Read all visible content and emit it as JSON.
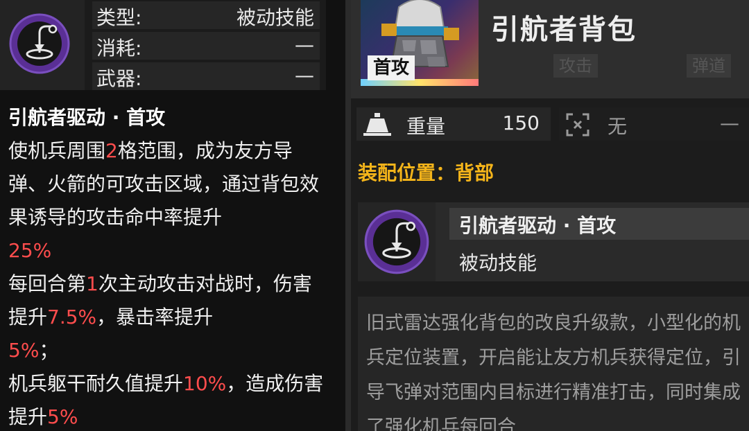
{
  "left": {
    "stats": [
      {
        "label": "类型:",
        "value": "被动技能"
      },
      {
        "label": "消耗:",
        "value": "—"
      },
      {
        "label": "武器:",
        "value": "—"
      }
    ],
    "skill_title": "引航者驱动 · 首攻",
    "desc": {
      "p1_a": "使机兵周围",
      "p1_hl1": "2",
      "p1_b": "格范围，成为友方导弹、火箭的可攻击区域，通过背包效果诱导的攻击命中率提升",
      "p1_hl2": "25%",
      "p2_a": "每回合第",
      "p2_hl1": "1",
      "p2_b": "次主动攻击对战时，伤害提升",
      "p2_hl2": "7.5%",
      "p2_c": "，暴击率提升",
      "p2_hl3": "5%",
      "p2_d": "；",
      "p3_a": "机兵躯干耐久值提升",
      "p3_hl1": "10%",
      "p3_b": "，造成伤害提升",
      "p3_hl2": "5%"
    },
    "highlight_color": "#ff4d4d"
  },
  "right": {
    "item_tag": "首攻",
    "item_title": "引航者背包",
    "ghost_buttons": [
      "攻击",
      "弹道"
    ],
    "weight_label": "重量",
    "weight_value": "150",
    "range_label": "无",
    "range_value": "—",
    "mount_label": "装配位置：背部",
    "skill_name": "引航者驱动 · 首攻",
    "skill_type": "被动技能",
    "lore": "旧式雷达强化背包的改良升级款，小型化的机兵定位装置，开启能让友方机兵获得定位，引导飞弹对范围内目标进行精准打击，同时集成了强化机兵每回合"
  },
  "icons": {
    "skill_icon": "guidance-beacon-icon",
    "weight_icon": "weight-icon",
    "range_icon": "crosshair-icon"
  },
  "colors": {
    "accent_purple": "#5a2f95",
    "mount_gold": "#f4b41a"
  }
}
